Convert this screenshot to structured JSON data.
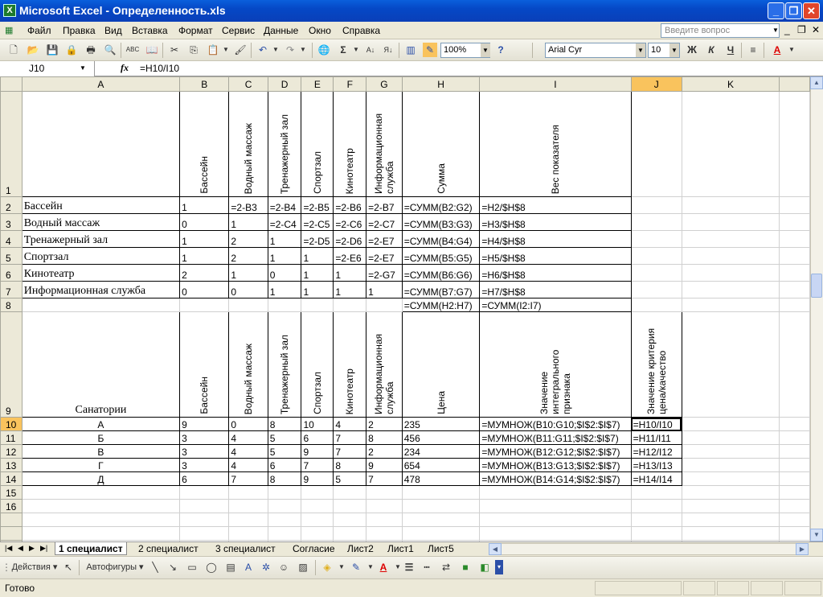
{
  "window": {
    "title": "Microsoft Excel - Определенность.xls",
    "min": "_",
    "max": "❐",
    "close": "✕"
  },
  "menu": [
    "Файл",
    "Правка",
    "Вид",
    "Вставка",
    "Формат",
    "Сервис",
    "Данные",
    "Окно",
    "Справка"
  ],
  "ask": {
    "placeholder": "Введите вопрос"
  },
  "toolbar": {
    "zoom": "100%",
    "font": "Arial Cyr",
    "size": "10",
    "bold": "Ж",
    "italic": "К",
    "underline": "Ч",
    "sum": "Σ",
    "help": "?"
  },
  "formula": {
    "cell": "J10",
    "fx": "fx",
    "content": "=H10/I10"
  },
  "columns": [
    "A",
    "B",
    "C",
    "D",
    "E",
    "F",
    "G",
    "H",
    "I",
    "J",
    "K"
  ],
  "rows": [
    {
      "n": "1",
      "a": "",
      "v": [
        "Бассейн",
        "Водный массаж",
        "Тренажерный зал",
        "Спортзал",
        "Кинотеатр",
        "Информационная служба",
        "Сумма",
        "Вес показателя",
        ""
      ]
    },
    {
      "n": "2",
      "a": "Бассейн",
      "v": [
        "1",
        "=2-B3",
        "=2-B4",
        "=2-B5",
        "=2-B6",
        "=2-B7",
        "=СУММ(B2:G2)",
        "=H2/$H$8",
        ""
      ]
    },
    {
      "n": "3",
      "a": "Водный массаж",
      "v": [
        "0",
        "1",
        "=2-C4",
        "=2-C5",
        "=2-C6",
        "=2-C7",
        "=СУММ(B3:G3)",
        "=H3/$H$8",
        ""
      ]
    },
    {
      "n": "4",
      "a": "Тренажерный зал",
      "v": [
        "1",
        "2",
        "1",
        "=2-D5",
        "=2-D6",
        "=2-E7",
        "=СУММ(B4:G4)",
        "=H4/$H$8",
        ""
      ]
    },
    {
      "n": "5",
      "a": "Спортзал",
      "v": [
        "1",
        "2",
        "1",
        "1",
        "=2-E6",
        "=2-E7",
        "=СУММ(B5:G5)",
        "=H5/$H$8",
        ""
      ]
    },
    {
      "n": "6",
      "a": "Кинотеатр",
      "v": [
        "2",
        "1",
        "0",
        "1",
        "1",
        "=2-G7",
        "=СУММ(B6:G6)",
        "=H6/$H$8",
        ""
      ]
    },
    {
      "n": "7",
      "a": "Информационная служба",
      "v": [
        "0",
        "0",
        "1",
        "1",
        "1",
        "1",
        "=СУММ(B7:G7)",
        "=H7/$H$8",
        ""
      ]
    },
    {
      "n": "8",
      "a": "",
      "v": [
        "",
        "",
        "",
        "",
        "",
        "",
        "=СУММ(H2:H7)",
        "=СУММ(I2:I7)",
        ""
      ]
    }
  ],
  "row9": {
    "n": "9",
    "a": "Санатории",
    "v": [
      "Бассейн",
      "Водный массаж",
      "Тренажерный зал",
      "Спортзал",
      "Кинотеатр",
      "Информационная служба",
      "Цена",
      "Значение интегрального признака",
      "Значение критерия цена/качество"
    ]
  },
  "san": [
    {
      "n": "10",
      "a": "А",
      "v": [
        "9",
        "0",
        "8",
        "10",
        "4",
        "2",
        "235",
        "=МУМНОЖ(B10:G10;$I$2:$I$7)",
        "=H10/I10"
      ]
    },
    {
      "n": "11",
      "a": "Б",
      "v": [
        "3",
        "4",
        "5",
        "6",
        "7",
        "8",
        "456",
        "=МУМНОЖ(B11:G11;$I$2:$I$7)",
        "=H11/I11"
      ]
    },
    {
      "n": "12",
      "a": "В",
      "v": [
        "3",
        "4",
        "5",
        "9",
        "7",
        "2",
        "234",
        "=МУМНОЖ(B12:G12;$I$2:$I$7)",
        "=H12/I12"
      ]
    },
    {
      "n": "13",
      "a": "Г",
      "v": [
        "3",
        "4",
        "6",
        "7",
        "8",
        "9",
        "654",
        "=МУМНОЖ(B13:G13;$I$2:$I$7)",
        "=H13/I13"
      ]
    },
    {
      "n": "14",
      "a": "Д",
      "v": [
        "6",
        "7",
        "8",
        "9",
        "5",
        "7",
        "478",
        "=МУМНОЖ(B14:G14;$I$2:$I$7)",
        "=H14/I14"
      ]
    }
  ],
  "empty_rows": [
    "15",
    "16"
  ],
  "tabs": [
    "1 специалист",
    "2 специалист",
    "3 специалист",
    "Согласие",
    "Лист2",
    "Лист1",
    "Лист5"
  ],
  "drawbar": {
    "actions": "Действия ▾",
    "autoshapes": "Автофигуры ▾"
  },
  "status": "Готово"
}
